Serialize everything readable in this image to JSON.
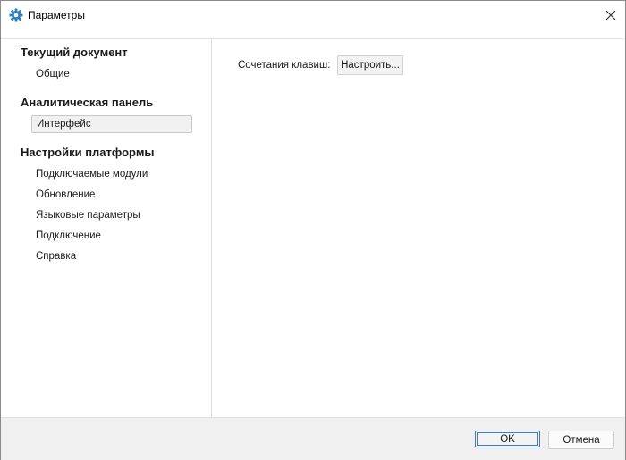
{
  "window": {
    "title": "Параметры"
  },
  "sidebar": {
    "sections": [
      {
        "header": "Текущий документ",
        "items": [
          "Общие"
        ]
      },
      {
        "header": "Аналитическая панель",
        "items": [
          "Интерфейс"
        ]
      },
      {
        "header": "Настройки платформы",
        "items": [
          "Подключаемые модули",
          "Обновление",
          "Языковые параметры",
          "Подключение",
          "Справка"
        ]
      }
    ],
    "selected": "Интерфейс"
  },
  "content": {
    "shortcuts_label": "Сочетания клавиш:",
    "configure_button": "Настроить..."
  },
  "footer": {
    "ok_label": "OK",
    "cancel_label": "Отмена"
  },
  "colors": {
    "gear_icon": "#2f7dbf",
    "selected_bg": "#f1f1f1"
  }
}
